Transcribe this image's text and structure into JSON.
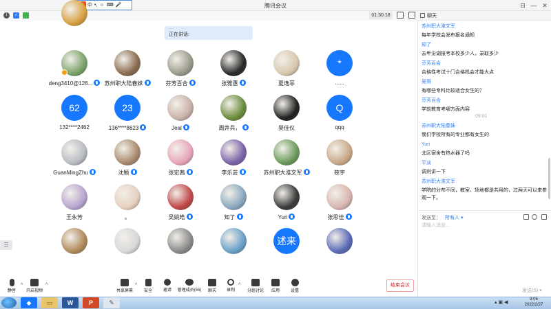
{
  "window": {
    "title": "腾讯会议"
  },
  "ime": {
    "logo": "S",
    "items": [
      "中",
      "•,",
      "☺",
      "⌨",
      "🎤",
      "👕",
      "⊞"
    ]
  },
  "meeting": {
    "timer": "01:30:18",
    "speaking_label": "正在讲话:"
  },
  "participants": [
    {
      "name": "deng3410@126...",
      "avatar": "photo",
      "color": "#7aa36a",
      "mic": true,
      "badge": true
    },
    {
      "name": "苏州职大陆春妹",
      "avatar": "photo",
      "color": "#8a6b4f",
      "mic": true
    },
    {
      "name": "芬芳百合",
      "avatar": "photo",
      "color": "#9a9a8a",
      "mic": true
    },
    {
      "name": "张雅惠",
      "avatar": "photo",
      "color": "#2a2a2a",
      "mic": true
    },
    {
      "name": "夏逸菲",
      "avatar": "photo",
      "color": "#d8c8b0",
      "mic": false
    },
    {
      "name": "......",
      "avatar": "text",
      "initial": "*",
      "mic": false
    },
    {
      "name": "132****2462",
      "avatar": "text",
      "initial": "62",
      "mic": false
    },
    {
      "name": "136****8623",
      "avatar": "text",
      "initial": "23",
      "mic": true
    },
    {
      "name": "Jeal",
      "avatar": "photo",
      "color": "#c9b2a8",
      "mic": true
    },
    {
      "name": "周井兵，",
      "avatar": "photo",
      "color": "#6a8d3c",
      "mic": true
    },
    {
      "name": "吴佳仪",
      "avatar": "photo",
      "color": "#222222",
      "mic": false
    },
    {
      "name": "qqq",
      "avatar": "text",
      "initial": "Q",
      "mic": false
    },
    {
      "name": "GuanMingZhu",
      "avatar": "photo",
      "color": "#b9bcc4",
      "mic": true
    },
    {
      "name": "沈颖",
      "avatar": "photo",
      "color": "#a88a6e",
      "mic": true
    },
    {
      "name": "张宏茜",
      "avatar": "photo",
      "color": "#e7a6b8",
      "mic": true
    },
    {
      "name": "李乐芸",
      "avatar": "photo",
      "color": "#7c63a8",
      "mic": true
    },
    {
      "name": "苏州职大淮文军",
      "avatar": "photo",
      "color": "#6a9a5a",
      "mic": true
    },
    {
      "name": "筱宇",
      "avatar": "photo",
      "color": "#c9a888",
      "mic": false
    },
    {
      "name": "王永芳",
      "avatar": "photo",
      "color": "#b7a4cf",
      "mic": false
    },
    {
      "name": "。",
      "avatar": "photo",
      "color": "#e7d0c0",
      "mic": false
    },
    {
      "name": "吴姚皓",
      "avatar": "photo",
      "color": "#c04848",
      "mic": true
    },
    {
      "name": "知了",
      "avatar": "photo",
      "color": "#8aa8c0",
      "mic": true
    },
    {
      "name": "Yuri",
      "avatar": "photo",
      "color": "#3a3a3a",
      "mic": true
    },
    {
      "name": "张思佳",
      "avatar": "photo",
      "color": "#d9b6b0",
      "mic": true
    },
    {
      "name": "",
      "avatar": "photo",
      "color": "#b08a5a",
      "mic": false
    },
    {
      "name": "",
      "avatar": "photo",
      "color": "#d8d8d8",
      "mic": false
    },
    {
      "name": "",
      "avatar": "photo",
      "color": "#8a8a8a",
      "mic": false
    },
    {
      "name": "",
      "avatar": "photo",
      "color": "#6aa0c8",
      "mic": false
    },
    {
      "name": "",
      "avatar": "text",
      "initial": "述来",
      "mic": false
    },
    {
      "name": "",
      "avatar": "photo",
      "color": "#5a6ab8",
      "mic": false
    },
    {
      "name": "",
      "avatar": "photo",
      "color": "#d8a040",
      "mic": false
    }
  ],
  "toolbar": {
    "mute": "静音",
    "video": "开启视频",
    "share": "共享屏幕",
    "security": "安全",
    "invite": "邀请",
    "members": "管理成员(55)",
    "chat": "聊天",
    "record": "录制",
    "breakout": "分组讨论",
    "apps": "应用",
    "settings": "设置",
    "end": "结束会议"
  },
  "chat": {
    "title": "聊天",
    "time_divider": "09:01",
    "messages_before": [
      {
        "sender": "苏州职大淮文军",
        "content": "每年学校会发布报名通知"
      },
      {
        "sender": "知了",
        "content": "去年汾湖报考本校多少人，录取多少"
      },
      {
        "sender": "芬芳百合",
        "content": "合格性考试十门合格机会才能大点"
      },
      {
        "sender": "吴哥",
        "content": "有哪些专科比较适合女生的？"
      },
      {
        "sender": "芬芳百合",
        "content": "学前教育考哪方面内容"
      }
    ],
    "messages_after": [
      {
        "sender": "苏州职大陆春妹",
        "content": "我们学校所有的专业都有女生的"
      },
      {
        "sender": "Yuri",
        "content": "北区宿舍有热水器了吗"
      },
      {
        "sender": "平淡",
        "content": "调剂讲一下"
      },
      {
        "sender": "苏州职大淮文军",
        "content": "学院的分布不同，教室、场地都是共用的，过两天可以来参观一下。"
      }
    ],
    "send_to_label": "发送至：",
    "send_to_value": "所有人",
    "input_placeholder": "请输入消息...",
    "send_button": "发送(S)"
  },
  "taskbar": {
    "time": "9:05",
    "date": "2022/2/27"
  }
}
